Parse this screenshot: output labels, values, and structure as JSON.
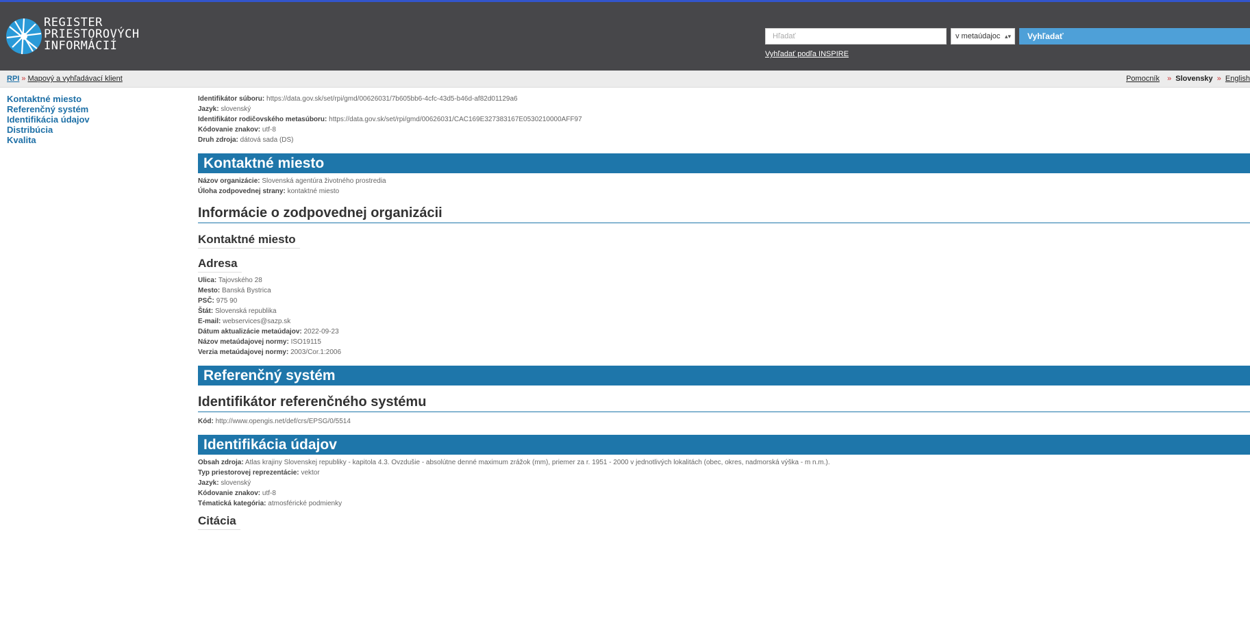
{
  "app": {
    "logo_lines": [
      "REGISTER",
      "PRIESTOROVÝCH",
      "INFORMÁCIÍ"
    ]
  },
  "search": {
    "placeholder": "Hľadať",
    "scope_value": "v metaúdajoc",
    "button_label": "Vyhľadať",
    "inspire_link": "Vyhľadať podľa INSPIRE"
  },
  "breadcrumb": {
    "home": "RPI",
    "separator": "»",
    "current": "Mapový a vyhľadávací klient"
  },
  "header_links": {
    "help": "Pomocník",
    "lang_current": "Slovensky",
    "lang_other": "English"
  },
  "sidebar": {
    "items": [
      {
        "label": "Kontaktné miesto"
      },
      {
        "label": "Referenčný systém"
      },
      {
        "label": "Identifikácia údajov"
      },
      {
        "label": "Distribúcia"
      },
      {
        "label": "Kvalita"
      }
    ]
  },
  "top_fields": [
    {
      "label": "Identifikátor súboru:",
      "value": "https://data.gov.sk/set/rpi/gmd/00626031/7b605bb6-4cfc-43d5-b46d-af82d01129a6"
    },
    {
      "label": "Jazyk:",
      "value": "slovenský"
    },
    {
      "label": "Identifikátor rodičovského metasúboru:",
      "value": "https://data.gov.sk/set/rpi/gmd/00626031/CAC169E327383167E0530210000AFF97"
    },
    {
      "label": "Kódovanie znakov:",
      "value": "utf-8"
    },
    {
      "label": "Druh zdroja:",
      "value": "dátová sada (DS)"
    }
  ],
  "section_contact": {
    "heading": "Kontaktné miesto",
    "fields": [
      {
        "label": "Názov organizácie:",
        "value": "Slovenská agentúra životného prostredia"
      },
      {
        "label": "Úloha zodpovednej strany:",
        "value": "kontaktné miesto"
      }
    ],
    "subheading": "Informácie o zodpovednej organizácii",
    "contact_heading": "Kontaktné miesto",
    "address_heading": "Adresa",
    "address_fields": [
      {
        "label": "Ulica:",
        "value": "Tajovského 28"
      },
      {
        "label": "Mesto:",
        "value": "Banská Bystrica"
      },
      {
        "label": "PSČ:",
        "value": "975 90"
      },
      {
        "label": "Štát:",
        "value": "Slovenská republika"
      },
      {
        "label": "E-mail:",
        "value": "webservices@sazp.sk"
      },
      {
        "label": "Dátum aktualizácie metaúdajov:",
        "value": "2022-09-23"
      },
      {
        "label": "Názov metaúdajovej normy:",
        "value": "ISO19115"
      },
      {
        "label": "Verzia metaúdajovej normy:",
        "value": "2003/Cor.1:2006"
      }
    ]
  },
  "section_reference": {
    "heading": "Referenčný systém",
    "subheading": "Identifikátor referenčného systému",
    "fields": [
      {
        "label": "Kód:",
        "value": "http://www.opengis.net/def/crs/EPSG/0/5514"
      }
    ]
  },
  "section_identification": {
    "heading": "Identifikácia údajov",
    "fields": [
      {
        "label": "Obsah zdroja:",
        "value": "Atlas krajiny Slovenskej republiky - kapitola 4.3. Ovzdušie - absolútne denné maximum zrážok (mm), priemer za r. 1951 - 2000 v jednotlivých lokalitách (obec, okres, nadmorská výška - m n.m.)."
      },
      {
        "label": "Typ priestorovej reprezentácie:",
        "value": "vektor"
      },
      {
        "label": "Jazyk:",
        "value": "slovenský"
      },
      {
        "label": "Kódovanie znakov:",
        "value": "utf-8"
      },
      {
        "label": "Tématická kategória:",
        "value": "atmosférické podmienky"
      }
    ],
    "citation_heading": "Citácia"
  },
  "colors": {
    "header_bg": "#47474a",
    "section_bar": "#1e76aa",
    "link_blue": "#1d6fa6",
    "search_button": "#4ea0d8"
  }
}
